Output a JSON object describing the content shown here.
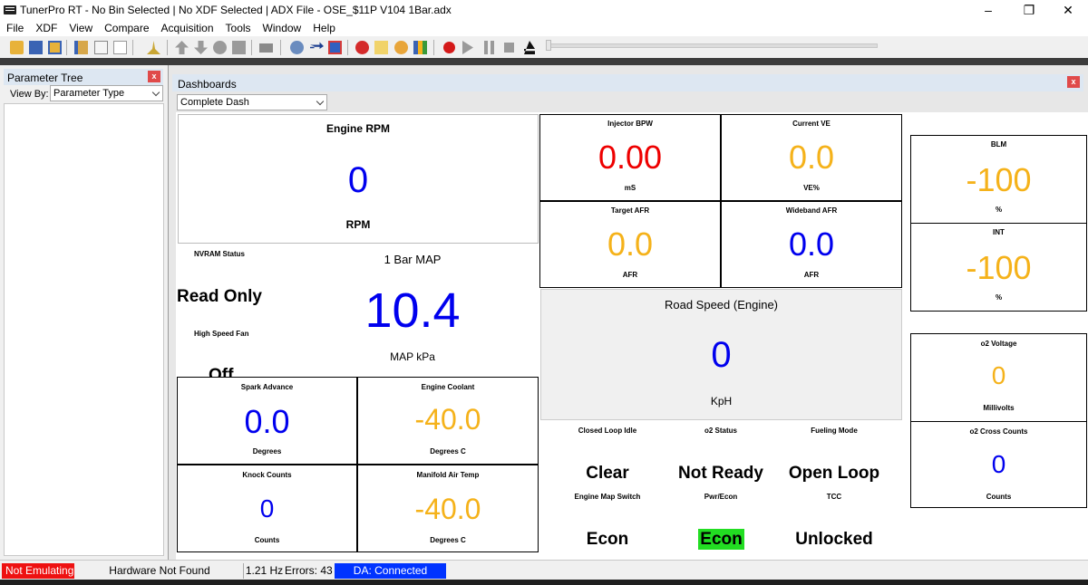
{
  "window": {
    "title": "TunerPro RT - No Bin Selected | No XDF Selected | ADX File - OSE_$11P V104 1Bar.adx"
  },
  "menu": [
    "File",
    "XDF",
    "View",
    "Compare",
    "Acquisition",
    "Tools",
    "Window",
    "Help"
  ],
  "parameter_tree": {
    "title": "Parameter Tree",
    "view_by_label": "View By:",
    "view_by_value": "Parameter Type"
  },
  "dashboards": {
    "title": "Dashboards",
    "selected_dash": "Complete Dash"
  },
  "gauges": {
    "engine_rpm": {
      "label": "Engine RPM",
      "value": "0",
      "unit": "RPM",
      "color": "#0000ee"
    },
    "injector_bpw": {
      "label": "Injector BPW",
      "value": "0.00",
      "unit": "mS",
      "color": "#ee0000"
    },
    "current_ve": {
      "label": "Current VE",
      "value": "0.0",
      "unit": "VE%",
      "color": "#f5b21a"
    },
    "target_afr": {
      "label": "Target AFR",
      "value": "0.0",
      "unit": "AFR",
      "color": "#f5b21a"
    },
    "wideband_afr": {
      "label": "Wideband AFR",
      "value": "0.0",
      "unit": "AFR",
      "color": "#0000ee"
    },
    "blm": {
      "label": "BLM",
      "value": "-100",
      "unit": "%",
      "color": "#f5b21a"
    },
    "int": {
      "label": "INT",
      "value": "-100",
      "unit": "%",
      "color": "#f5b21a"
    },
    "map": {
      "label": "1 Bar MAP",
      "value": "10.4",
      "unit": "MAP kPa",
      "color": "#0000ee"
    },
    "road_speed": {
      "label": "Road Speed (Engine)",
      "value": "0",
      "unit": "KpH",
      "color": "#0000ee"
    },
    "o2_voltage": {
      "label": "o2 Voltage",
      "value": "0",
      "unit": "Millivolts",
      "color": "#f5b21a"
    },
    "o2_cross_counts": {
      "label": "o2 Cross Counts",
      "value": "0",
      "unit": "Counts",
      "color": "#0000ee"
    },
    "spark_advance": {
      "label": "Spark Advance",
      "value": "0.0",
      "unit": "Degrees",
      "color": "#0000ee"
    },
    "engine_coolant": {
      "label": "Engine Coolant",
      "value": "-40.0",
      "unit": "Degrees C",
      "color": "#f5b21a"
    },
    "knock_counts": {
      "label": "Knock Counts",
      "value": "0",
      "unit": "Counts",
      "color": "#0000ee"
    },
    "manifold_air_temp": {
      "label": "Manifold Air Temp",
      "value": "-40.0",
      "unit": "Degrees C",
      "color": "#f5b21a"
    }
  },
  "indicators": {
    "nvram_status": {
      "label": "NVRAM Status",
      "value": "Read Only"
    },
    "high_speed_fan": {
      "label": "High Speed Fan",
      "value": "Off"
    },
    "closed_loop_idle": {
      "label": "Closed Loop Idle",
      "value": "Clear"
    },
    "o2_status": {
      "label": "o2 Status",
      "value": "Not Ready"
    },
    "fueling_mode": {
      "label": "Fueling Mode",
      "value": "Open Loop"
    },
    "engine_map_switch": {
      "label": "Engine Map Switch",
      "value": "Econ"
    },
    "pwr_econ": {
      "label": "Pwr/Econ",
      "value": "Econ",
      "highlight_color": "#22dd22"
    },
    "tcc": {
      "label": "TCC",
      "value": "Unlocked"
    }
  },
  "status_bar": {
    "emulation": "Not Emulating",
    "hardware": "Hardware Not Found",
    "rate": "1.21 Hz",
    "errors": "Errors: 43",
    "da_status": "DA: Connected"
  },
  "colors": {
    "not_emulating_bg": "#ee1111",
    "da_connected_bg": "#0033ff"
  }
}
